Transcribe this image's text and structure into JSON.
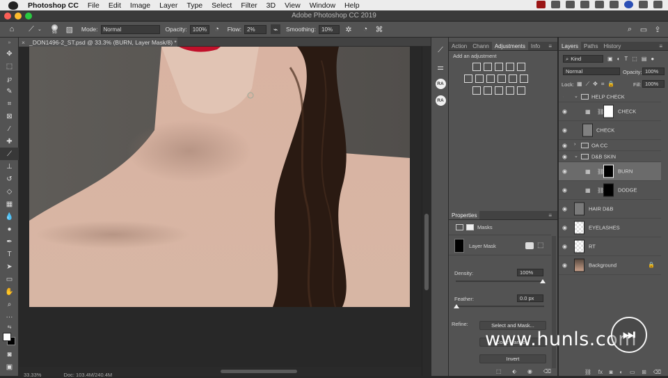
{
  "menubar": {
    "app_name": "Photoshop CC",
    "items": [
      "File",
      "Edit",
      "Image",
      "Layer",
      "Type",
      "Select",
      "Filter",
      "3D",
      "View",
      "Window",
      "Help"
    ]
  },
  "window": {
    "title": "Adobe Photoshop CC 2019"
  },
  "options_bar": {
    "brush_size": "98",
    "mode_label": "Mode:",
    "mode_value": "Normal",
    "opacity_label": "Opacity:",
    "opacity_value": "100%",
    "flow_label": "Flow:",
    "flow_value": "2%",
    "smoothing_label": "Smoothing:",
    "smoothing_value": "10%"
  },
  "document": {
    "tab_title": "_DON1496-2_ST.psd @ 33.3% (BURN, Layer Mask/8) *",
    "zoom": "33.33%",
    "doc_size": "Doc: 103.4M/240.4M"
  },
  "adjustments_panel": {
    "tabs": [
      "Action",
      "Chann",
      "Adjustments",
      "Info"
    ],
    "active_tab": "Adjustments",
    "hint": "Add an adjustment"
  },
  "properties_panel": {
    "title": "Properties",
    "section": "Masks",
    "mask_type": "Layer Mask",
    "density_label": "Density:",
    "density_value": "100%",
    "feather_label": "Feather:",
    "feather_value": "0.0 px",
    "refine_label": "Refine:",
    "select_mask_button": "Select and Mask...",
    "color_range_button": "Color Range...",
    "invert_button": "Invert"
  },
  "layers_panel": {
    "tabs": [
      "Layers",
      "Paths",
      "History"
    ],
    "active_tab": "Layers",
    "filter_kind": "Kind",
    "blend_mode": "Normal",
    "opacity_label": "Opacity:",
    "opacity_value": "100%",
    "lock_label": "Lock:",
    "fill_label": "Fill:",
    "fill_value": "100%",
    "layers": [
      {
        "name": "HELP CHECK",
        "type": "group",
        "visible": false
      },
      {
        "name": "CHECK",
        "type": "adjust",
        "visible": true
      },
      {
        "name": "CHECK",
        "type": "pixel",
        "visible": true
      },
      {
        "name": "OA CC",
        "type": "group",
        "visible": true
      },
      {
        "name": "D&B SKIN",
        "type": "group",
        "visible": true
      },
      {
        "name": "BURN",
        "type": "adjust",
        "visible": true,
        "selected": true
      },
      {
        "name": "DODGE",
        "type": "adjust",
        "visible": true
      },
      {
        "name": "HAIR D&B",
        "type": "pixel",
        "visible": true
      },
      {
        "name": "EYELASHES",
        "type": "pixel",
        "visible": true
      },
      {
        "name": "RT",
        "type": "pixel",
        "visible": true
      },
      {
        "name": "Background",
        "type": "background",
        "visible": true
      }
    ]
  },
  "watermark": {
    "text": "www.hunls.com"
  },
  "colors": {
    "panel_bg": "#535353",
    "dark_bg": "#282828",
    "selected_layer": "#6b6b6b"
  }
}
